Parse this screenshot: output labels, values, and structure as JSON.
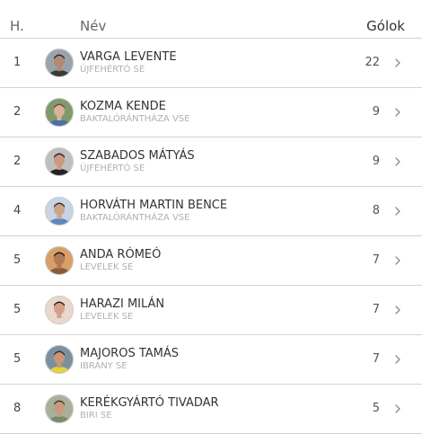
{
  "header": {
    "rank_label": "H.",
    "name_label": "Név",
    "goals_label": "Gólok"
  },
  "rows": [
    {
      "rank": "1",
      "name": "VARGA LEVENTE",
      "team": "ÚJFEHÉRTÓ SE",
      "goals": "22",
      "avatar": {
        "skin": "#b08a73",
        "hair": "#2a2a2a",
        "shirt": "#3a3a3a",
        "bg": "#9aa3ab"
      }
    },
    {
      "rank": "2",
      "name": "KOZMA KENDE",
      "team": "BAKTALÓRÁNTHÁZA VSE",
      "goals": "9",
      "avatar": {
        "skin": "#d8b39a",
        "hair": "#6b4a32",
        "shirt": "#4a6fa8",
        "bg": "#7f9a6a"
      }
    },
    {
      "rank": "2",
      "name": "SZABADOS MÁTYÁS",
      "team": "ÚJFEHÉRTÓ SE",
      "goals": "9",
      "avatar": {
        "skin": "#c99a80",
        "hair": "#2b211b",
        "shirt": "#222222",
        "bg": "#bfbfbf"
      }
    },
    {
      "rank": "4",
      "name": "HORVÁTH MARTIN BENCE",
      "team": "BAKTALÓRÁNTHÁZA VSE",
      "goals": "8",
      "avatar": {
        "skin": "#caa48c",
        "hair": "#3b2a20",
        "shirt": "#5b87c2",
        "bg": "#c7d4e3"
      }
    },
    {
      "rank": "5",
      "name": "ANDA RÓMEÓ",
      "team": "LEVELEK SE",
      "goals": "7",
      "avatar": {
        "skin": "#b07a55",
        "hair": "#1f1712",
        "shirt": "#8a5a3a",
        "bg": "#d8a066"
      }
    },
    {
      "rank": "5",
      "name": "HARAZI MILÁN",
      "team": "LEVELEK SE",
      "goals": "7",
      "avatar": {
        "skin": "#d2a088",
        "hair": "#2a1c14",
        "shirt": "#e8d8cf",
        "bg": "#e9d7cc"
      }
    },
    {
      "rank": "5",
      "name": "MAJOROS TAMÁS",
      "team": "IBRÁNY SE",
      "goals": "7",
      "avatar": {
        "skin": "#c99578",
        "hair": "#3a2a20",
        "shirt": "#e6d23a",
        "bg": "#7c8f9e"
      }
    },
    {
      "rank": "8",
      "name": "KERÉKGYÁRTÓ TIVADAR",
      "team": "BIRI SE",
      "goals": "5",
      "avatar": {
        "skin": "#c79a80",
        "hair": "#4a3628",
        "shirt": "#7a8a6a",
        "bg": "#a8b09a"
      }
    }
  ],
  "colors": {
    "divider": "#d2d2d2",
    "team_text": "#b0b0b0",
    "chevron": "#8a8a8a"
  }
}
